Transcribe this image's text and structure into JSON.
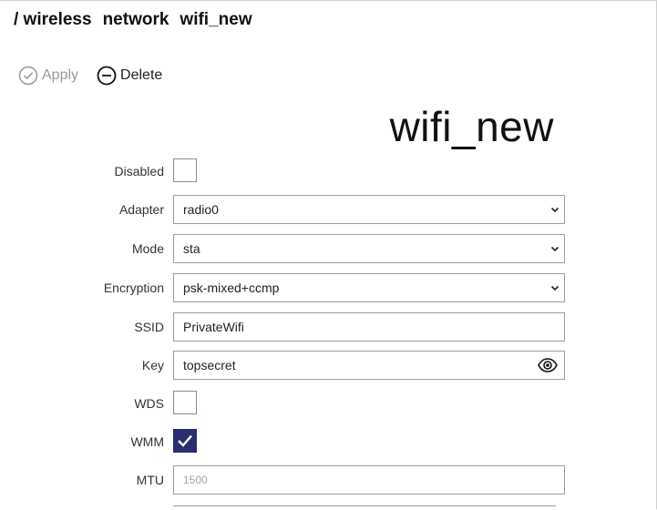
{
  "breadcrumb": [
    "/ wireless",
    "network",
    "wifi_new"
  ],
  "toolbar": {
    "apply_label": "Apply",
    "delete_label": "Delete"
  },
  "title": "wifi_new",
  "form": {
    "disabled": {
      "label": "Disabled",
      "checked": false
    },
    "adapter": {
      "label": "Adapter",
      "value": "radio0"
    },
    "mode": {
      "label": "Mode",
      "value": "sta"
    },
    "encryption": {
      "label": "Encryption",
      "value": "psk-mixed+ccmp"
    },
    "ssid": {
      "label": "SSID",
      "value": "PrivateWifi"
    },
    "key": {
      "label": "Key",
      "value": "topsecret"
    },
    "wds": {
      "label": "WDS",
      "checked": false
    },
    "wmm": {
      "label": "WMM",
      "checked": true
    },
    "mtu": {
      "label": "MTU",
      "placeholder": "1500"
    }
  },
  "colors": {
    "checkbox_checked": "#2b2e6e",
    "disabled_text": "#9a9a9a"
  }
}
